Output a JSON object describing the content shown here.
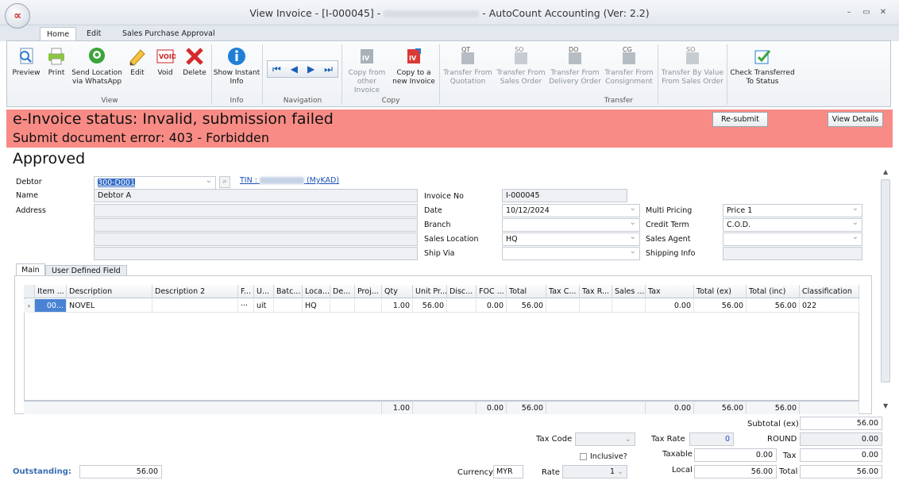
{
  "window": {
    "title_prefix": "View Invoice - [I-000045] - ",
    "title_suffix": " - AutoCount Accounting (Ver: 2.2)",
    "minimize": "–",
    "maximize": "▭",
    "close": "✕",
    "logo_text": "∝"
  },
  "tabs": [
    "Home",
    "Edit",
    "Sales Purchase Approval"
  ],
  "ribbon": {
    "view": {
      "group": "View",
      "preview": "Preview",
      "print": "Print",
      "send_whatsapp_1": "Send Location",
      "send_whatsapp_2": "via WhatsApp",
      "edit": "Edit",
      "void": "Void",
      "delete": "Delete"
    },
    "info": {
      "group": "Info",
      "show_1": "Show Instant",
      "show_2": "Info"
    },
    "navigation": {
      "group": "Navigation"
    },
    "copy": {
      "group": "Copy",
      "copy_from_1": "Copy from",
      "copy_from_2": "other Invoice",
      "copy_to_1": "Copy to a",
      "copy_to_2": "new Invoice"
    },
    "transfer": {
      "group": "Transfer",
      "quotation_1": "Transfer From",
      "quotation_2": "Quotation",
      "so_1": "Transfer From",
      "so_2": "Sales Order",
      "do_1": "Transfer From",
      "do_2": "Delivery Order",
      "cons_1": "Transfer From",
      "cons_2": "Consignment",
      "byval_1": "Transfer By Value",
      "byval_2": "From Sales Order",
      "check_1": "Check Transferred",
      "check_2": "To Status"
    }
  },
  "banner": {
    "line1": "e-Invoice status: Invalid, submission failed",
    "line2": "Submit document error: 403 - Forbidden",
    "resubmit": "Re-submit",
    "view_details": "View Details"
  },
  "status_title": "Approved",
  "header": {
    "debtor_label": "Debtor",
    "debtor": "300-D001",
    "tin_prefix": "TIN : ",
    "tin_suffix": " (MyKAD)",
    "name_label": "Name",
    "name": "Debtor A",
    "address_label": "Address",
    "invoice_no_label": "Invoice No",
    "invoice_no": "I-000045",
    "date_label": "Date",
    "date": "10/12/2024",
    "branch_label": "Branch",
    "branch": "",
    "sales_location_label": "Sales Location",
    "sales_location": "HQ",
    "ship_via_label": "Ship Via",
    "ship_via": "",
    "multi_pricing_label": "Multi Pricing",
    "multi_pricing": "Price 1",
    "credit_term_label": "Credit Term",
    "credit_term": "C.O.D.",
    "sales_agent_label": "Sales Agent",
    "sales_agent": "",
    "shipping_info_label": "Shipping Info",
    "shipping_info": ""
  },
  "detail_tabs": [
    "Main",
    "User Defined Field"
  ],
  "grid": {
    "columns": [
      "Item ...",
      "Description",
      "Description 2",
      "F...",
      "U...",
      "Batc...",
      "Loca...",
      "De...",
      "Proj...",
      "Qty",
      "Unit Pr...",
      "Disc...",
      "FOC ...",
      "Total",
      "Tax C...",
      "Tax R...",
      "Sales ...",
      "Tax",
      "Total (ex)",
      "Total (inc)",
      "Classification"
    ],
    "rows": [
      {
        "item": "00...",
        "desc": "NOVEL",
        "desc2": "",
        "f": "···",
        "u": "uit",
        "batch": "",
        "loc": "HQ",
        "de": "",
        "proj": "",
        "qty": "1.00",
        "unit_price": "56.00",
        "disc": "",
        "foc": "0.00",
        "total": "56.00",
        "tax_code": "",
        "tax_rate": "",
        "sales": "",
        "tax": "0.00",
        "total_ex": "56.00",
        "total_inc": "56.00",
        "classification": "022"
      }
    ],
    "footer": {
      "qty": "1.00",
      "foc": "0.00",
      "total": "56.00",
      "tax": "0.00",
      "total_ex": "56.00",
      "total_inc": "56.00"
    }
  },
  "summary": {
    "subtotal_ex_label": "Subtotal (ex)",
    "subtotal_ex": "56.00",
    "tax_code_label": "Tax Code",
    "tax_code": "",
    "tax_rate_label": "Tax Rate",
    "tax_rate": "0",
    "round_label": "ROUND",
    "round": "0.00",
    "inclusive_label": "Inclusive?",
    "taxable_label": "Taxable",
    "taxable": "0.00",
    "tax_label": "Tax",
    "tax": "0.00",
    "outstanding_label": "Outstanding:",
    "outstanding": "56.00",
    "currency_label": "Currency",
    "currency": "MYR",
    "rate_label": "Rate",
    "rate": "1",
    "local_label": "Local",
    "local": "56.00",
    "total_label": "Total",
    "total": "56.00"
  },
  "colors": {
    "banner": "#f88b85",
    "outstanding": "#3a6fb0",
    "link": "#1a4fb5"
  }
}
